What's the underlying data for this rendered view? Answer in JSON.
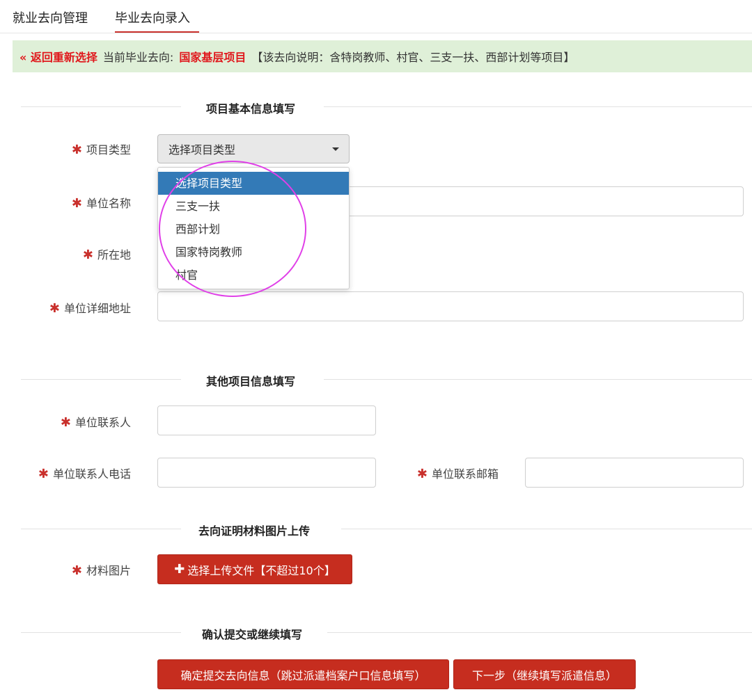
{
  "tabs": [
    {
      "label": "就业去向管理"
    },
    {
      "label": "毕业去向录入"
    }
  ],
  "info": {
    "back_link": "« 返回重新选择",
    "current_prefix": "当前毕业去向:",
    "current_destination": "国家基层项目",
    "description": "【该去向说明：含特岗教师、村官、三支一扶、西部计划等项目】"
  },
  "sections": {
    "basic": "项目基本信息填写",
    "other": "其他项目信息填写",
    "upload": "去向证明材料图片上传",
    "confirm": "确认提交或继续填写"
  },
  "required_mark": "✱",
  "fields": {
    "project_type": {
      "label": "项目类型",
      "selected": "选择项目类型"
    },
    "unit_name": {
      "label": "单位名称",
      "value": ""
    },
    "location": {
      "label": "所在地"
    },
    "unit_address": {
      "label": "单位详细地址",
      "value": ""
    },
    "contact": {
      "label": "单位联系人",
      "value": ""
    },
    "contact_phone": {
      "label": "单位联系人电话",
      "value": ""
    },
    "contact_email": {
      "label": "单位联系邮箱",
      "value": ""
    },
    "materials": {
      "label": "材料图片"
    }
  },
  "dropdown_options": [
    "选择项目类型",
    "三支一扶",
    "西部计划",
    "国家特岗教师",
    "村官"
  ],
  "buttons": {
    "upload": "选择上传文件【不超过10个】",
    "submit": "确定提交去向信息（跳过派遣档案户口信息填写）",
    "next": "下一步（继续填写派遣信息）"
  },
  "colors": {
    "accent_red": "#c62d1f",
    "highlight_blue": "#337ab7",
    "info_bg": "#dff0d8",
    "annotation_circle": "#e040e8"
  }
}
